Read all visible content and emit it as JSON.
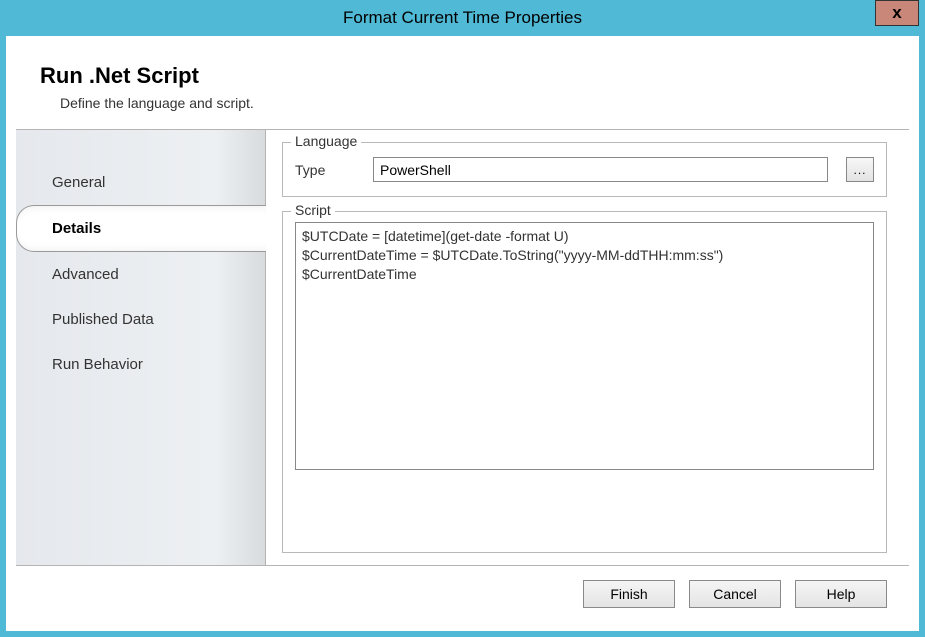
{
  "window": {
    "title": "Format Current Time Properties",
    "close_symbol": "x"
  },
  "header": {
    "title": "Run .Net Script",
    "subtitle": "Define the language and script."
  },
  "sidebar": {
    "items": [
      {
        "label": "General",
        "active": false
      },
      {
        "label": "Details",
        "active": true
      },
      {
        "label": "Advanced",
        "active": false
      },
      {
        "label": "Published Data",
        "active": false
      },
      {
        "label": "Run Behavior",
        "active": false
      }
    ]
  },
  "language": {
    "legend": "Language",
    "type_label": "Type",
    "type_value": "PowerShell",
    "browse_label": "..."
  },
  "script": {
    "legend": "Script",
    "content": "$UTCDate = [datetime](get-date -format U)\n$CurrentDateTime = $UTCDate.ToString(\"yyyy-MM-ddTHH:mm:ss\")\n$CurrentDateTime"
  },
  "footer": {
    "finish": "Finish",
    "cancel": "Cancel",
    "help": "Help"
  }
}
